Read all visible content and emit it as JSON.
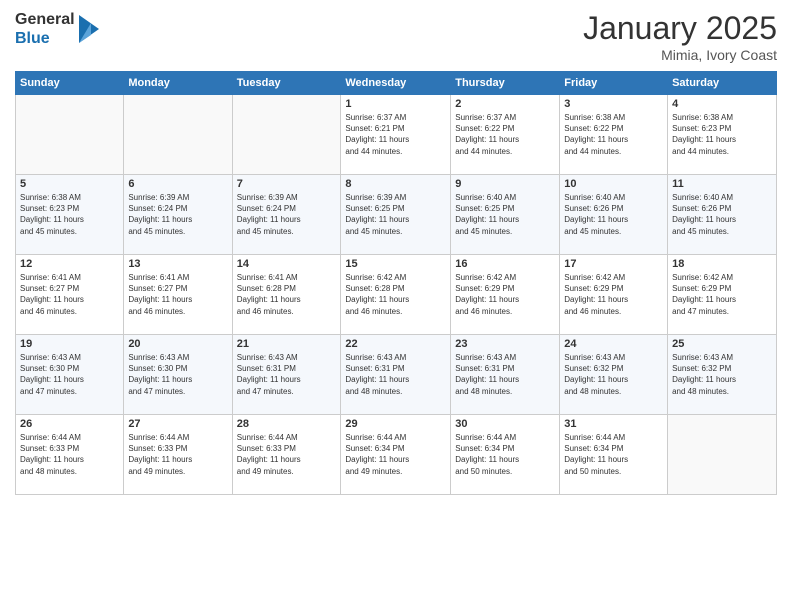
{
  "logo": {
    "general": "General",
    "blue": "Blue"
  },
  "header": {
    "month": "January 2025",
    "location": "Mimia, Ivory Coast"
  },
  "weekdays": [
    "Sunday",
    "Monday",
    "Tuesday",
    "Wednesday",
    "Thursday",
    "Friday",
    "Saturday"
  ],
  "weeks": [
    [
      {
        "day": "",
        "info": ""
      },
      {
        "day": "",
        "info": ""
      },
      {
        "day": "",
        "info": ""
      },
      {
        "day": "1",
        "info": "Sunrise: 6:37 AM\nSunset: 6:21 PM\nDaylight: 11 hours\nand 44 minutes."
      },
      {
        "day": "2",
        "info": "Sunrise: 6:37 AM\nSunset: 6:22 PM\nDaylight: 11 hours\nand 44 minutes."
      },
      {
        "day": "3",
        "info": "Sunrise: 6:38 AM\nSunset: 6:22 PM\nDaylight: 11 hours\nand 44 minutes."
      },
      {
        "day": "4",
        "info": "Sunrise: 6:38 AM\nSunset: 6:23 PM\nDaylight: 11 hours\nand 44 minutes."
      }
    ],
    [
      {
        "day": "5",
        "info": "Sunrise: 6:38 AM\nSunset: 6:23 PM\nDaylight: 11 hours\nand 45 minutes."
      },
      {
        "day": "6",
        "info": "Sunrise: 6:39 AM\nSunset: 6:24 PM\nDaylight: 11 hours\nand 45 minutes."
      },
      {
        "day": "7",
        "info": "Sunrise: 6:39 AM\nSunset: 6:24 PM\nDaylight: 11 hours\nand 45 minutes."
      },
      {
        "day": "8",
        "info": "Sunrise: 6:39 AM\nSunset: 6:25 PM\nDaylight: 11 hours\nand 45 minutes."
      },
      {
        "day": "9",
        "info": "Sunrise: 6:40 AM\nSunset: 6:25 PM\nDaylight: 11 hours\nand 45 minutes."
      },
      {
        "day": "10",
        "info": "Sunrise: 6:40 AM\nSunset: 6:26 PM\nDaylight: 11 hours\nand 45 minutes."
      },
      {
        "day": "11",
        "info": "Sunrise: 6:40 AM\nSunset: 6:26 PM\nDaylight: 11 hours\nand 45 minutes."
      }
    ],
    [
      {
        "day": "12",
        "info": "Sunrise: 6:41 AM\nSunset: 6:27 PM\nDaylight: 11 hours\nand 46 minutes."
      },
      {
        "day": "13",
        "info": "Sunrise: 6:41 AM\nSunset: 6:27 PM\nDaylight: 11 hours\nand 46 minutes."
      },
      {
        "day": "14",
        "info": "Sunrise: 6:41 AM\nSunset: 6:28 PM\nDaylight: 11 hours\nand 46 minutes."
      },
      {
        "day": "15",
        "info": "Sunrise: 6:42 AM\nSunset: 6:28 PM\nDaylight: 11 hours\nand 46 minutes."
      },
      {
        "day": "16",
        "info": "Sunrise: 6:42 AM\nSunset: 6:29 PM\nDaylight: 11 hours\nand 46 minutes."
      },
      {
        "day": "17",
        "info": "Sunrise: 6:42 AM\nSunset: 6:29 PM\nDaylight: 11 hours\nand 46 minutes."
      },
      {
        "day": "18",
        "info": "Sunrise: 6:42 AM\nSunset: 6:29 PM\nDaylight: 11 hours\nand 47 minutes."
      }
    ],
    [
      {
        "day": "19",
        "info": "Sunrise: 6:43 AM\nSunset: 6:30 PM\nDaylight: 11 hours\nand 47 minutes."
      },
      {
        "day": "20",
        "info": "Sunrise: 6:43 AM\nSunset: 6:30 PM\nDaylight: 11 hours\nand 47 minutes."
      },
      {
        "day": "21",
        "info": "Sunrise: 6:43 AM\nSunset: 6:31 PM\nDaylight: 11 hours\nand 47 minutes."
      },
      {
        "day": "22",
        "info": "Sunrise: 6:43 AM\nSunset: 6:31 PM\nDaylight: 11 hours\nand 48 minutes."
      },
      {
        "day": "23",
        "info": "Sunrise: 6:43 AM\nSunset: 6:31 PM\nDaylight: 11 hours\nand 48 minutes."
      },
      {
        "day": "24",
        "info": "Sunrise: 6:43 AM\nSunset: 6:32 PM\nDaylight: 11 hours\nand 48 minutes."
      },
      {
        "day": "25",
        "info": "Sunrise: 6:43 AM\nSunset: 6:32 PM\nDaylight: 11 hours\nand 48 minutes."
      }
    ],
    [
      {
        "day": "26",
        "info": "Sunrise: 6:44 AM\nSunset: 6:33 PM\nDaylight: 11 hours\nand 48 minutes."
      },
      {
        "day": "27",
        "info": "Sunrise: 6:44 AM\nSunset: 6:33 PM\nDaylight: 11 hours\nand 49 minutes."
      },
      {
        "day": "28",
        "info": "Sunrise: 6:44 AM\nSunset: 6:33 PM\nDaylight: 11 hours\nand 49 minutes."
      },
      {
        "day": "29",
        "info": "Sunrise: 6:44 AM\nSunset: 6:34 PM\nDaylight: 11 hours\nand 49 minutes."
      },
      {
        "day": "30",
        "info": "Sunrise: 6:44 AM\nSunset: 6:34 PM\nDaylight: 11 hours\nand 50 minutes."
      },
      {
        "day": "31",
        "info": "Sunrise: 6:44 AM\nSunset: 6:34 PM\nDaylight: 11 hours\nand 50 minutes."
      },
      {
        "day": "",
        "info": ""
      }
    ]
  ]
}
